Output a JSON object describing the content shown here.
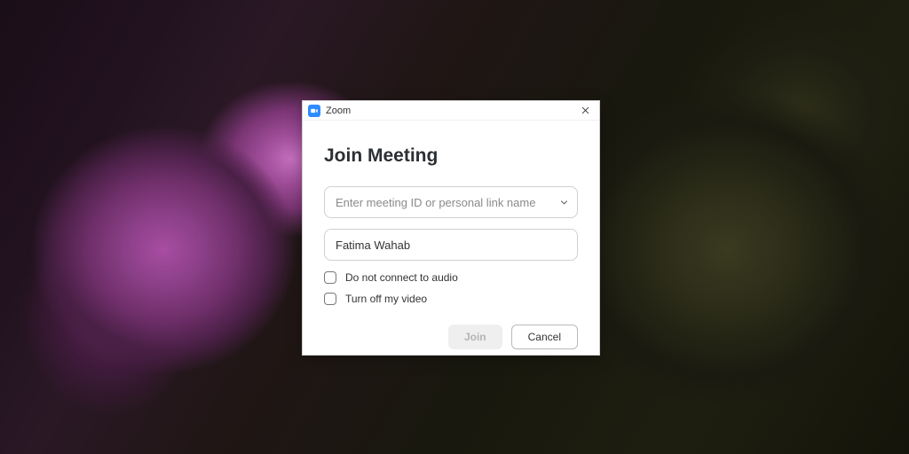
{
  "window": {
    "title": "Zoom"
  },
  "dialog": {
    "heading": "Join Meeting",
    "meeting_id": {
      "placeholder": "Enter meeting ID or personal link name",
      "value": ""
    },
    "name": {
      "value": "Fatima Wahab"
    },
    "options": {
      "audio_label": "Do not connect to audio",
      "video_label": "Turn off my video"
    },
    "buttons": {
      "join": "Join",
      "cancel": "Cancel"
    }
  }
}
